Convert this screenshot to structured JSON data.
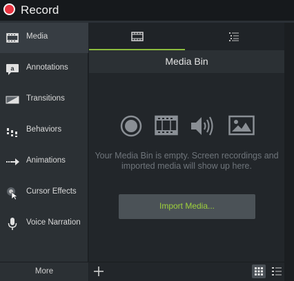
{
  "topbar": {
    "record_label": "Record"
  },
  "sidebar": {
    "items": [
      {
        "label": "Media",
        "icon": "filmstrip-icon",
        "active": true
      },
      {
        "label": "Annotations",
        "icon": "annotation-icon",
        "active": false
      },
      {
        "label": "Transitions",
        "icon": "transition-icon",
        "active": false
      },
      {
        "label": "Behaviors",
        "icon": "behaviors-icon",
        "active": false
      },
      {
        "label": "Animations",
        "icon": "animation-arrow-icon",
        "active": false
      },
      {
        "label": "Cursor Effects",
        "icon": "cursor-icon",
        "active": false
      },
      {
        "label": "Voice Narration",
        "icon": "microphone-icon",
        "active": false
      }
    ],
    "more_label": "More"
  },
  "main": {
    "tabs": [
      {
        "icon": "filmstrip-icon",
        "active": true
      },
      {
        "icon": "list-icon",
        "active": false
      }
    ],
    "bin_title": "Media Bin",
    "media_icons": [
      "record-icon",
      "video-icon",
      "audio-icon",
      "image-icon"
    ],
    "empty_message": "Your Media Bin is empty. Screen recordings and imported media will show up here.",
    "import_label": "Import Media..."
  },
  "colors": {
    "record": "#e83340",
    "accent": "#8dbd3e",
    "import_text": "#9ed13c"
  }
}
